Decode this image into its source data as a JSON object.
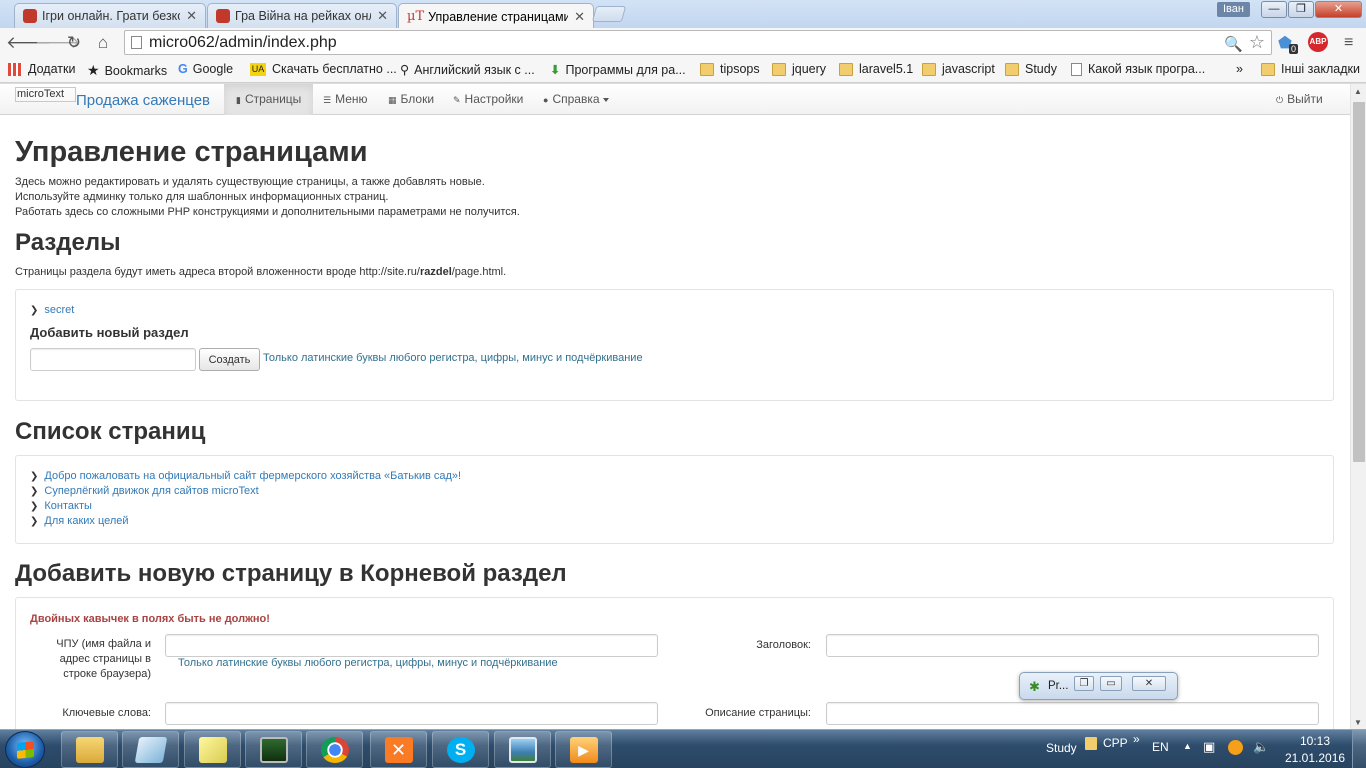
{
  "browser": {
    "tabs": [
      {
        "title": "Ігри онлайн. Грати безкош",
        "active": false
      },
      {
        "title": "Гра Війна на рейках онлай",
        "active": false
      },
      {
        "title": "Управление страницами",
        "active": true,
        "favicon_text": "µT"
      }
    ],
    "user_badge": "Іван",
    "window_buttons": {
      "minimize": "—",
      "maximize": "❐",
      "close": "✕"
    },
    "url": "micro062/admin/index.php",
    "abp_label": "ABP",
    "extension_badge": "0",
    "bookmarks": [
      {
        "label": "Додатки",
        "icon": "apps-icon"
      },
      {
        "label": "Bookmarks",
        "icon": "star-icon"
      },
      {
        "label": "Google",
        "icon": "google-icon"
      },
      {
        "label": "Скачать бесплатно ...",
        "icon": "ua-icon"
      },
      {
        "label": "Английский язык с ...",
        "icon": "runner-icon"
      },
      {
        "label": "Программы для ра...",
        "icon": "download-icon"
      },
      {
        "label": "tipsops",
        "icon": "folder-icon"
      },
      {
        "label": "jquery",
        "icon": "folder-icon"
      },
      {
        "label": "laravel5.1",
        "icon": "folder-icon"
      },
      {
        "label": "javascript",
        "icon": "folder-icon"
      },
      {
        "label": "Study",
        "icon": "folder-icon"
      },
      {
        "label": "Какой язык програ...",
        "icon": "page-icon"
      }
    ],
    "bookmarks_overflow": "»",
    "other_bookmarks": "Інші закладки"
  },
  "site": {
    "brand_img_alt": "microText",
    "brand_title": "Продажа саженцев",
    "nav": [
      {
        "label": "Страницы",
        "icon": "file-icon",
        "active": true
      },
      {
        "label": "Меню",
        "icon": "list-icon",
        "active": false
      },
      {
        "label": "Блоки",
        "icon": "blocks-icon",
        "active": false
      },
      {
        "label": "Настройки",
        "icon": "wrench-icon",
        "active": false
      },
      {
        "label": "Справка",
        "icon": "info-icon",
        "active": false,
        "dropdown": true
      }
    ],
    "logout": "Выйти"
  },
  "main": {
    "title": "Управление страницами",
    "intro": [
      "Здесь можно редактировать и удалять существующие страницы, а также добавлять новые.",
      "Используйте админку только для шаблонных информационных страниц.",
      "Работать здесь со сложными PHP конструкциями и дополнительными параметрами не получится."
    ],
    "sections": {
      "title": "Разделы",
      "note_prefix": "Страницы раздела будут иметь адреса второй вложенности вроде http://site.ru/",
      "note_bold": "razdel",
      "note_suffix": "/page.html.",
      "items": [
        "secret"
      ],
      "add_title": "Добавить новый раздел",
      "add_input_value": "",
      "create_button": "Создать",
      "hint": "Только латинские буквы любого регистра, цифры, минус и подчёркивание"
    },
    "pages": {
      "title": "Список страниц",
      "items": [
        "Добро пожаловать на официальный сайт фермерского хозяйства «Батькив сад»!",
        "Суперлёгкий движок для сайтов microText",
        "Контакты",
        "Для каких целей"
      ]
    },
    "add_page": {
      "title": "Добавить новую страницу в Корневой раздел",
      "warning": "Двойных кавычек в полях быть не должно!",
      "slug_label": "ЧПУ (имя файла и адрес страницы в строке браузера)",
      "slug_hint": "Только латинские буквы любого регистра, цифры, минус и подчёркивание",
      "heading_label": "Заголовок:",
      "keywords_label": "Ключевые слова:",
      "description_label": "Описание страницы:"
    }
  },
  "floating_window": {
    "title": "Pr..."
  },
  "taskbar": {
    "apps": [
      "explorer-icon",
      "notepad-icon",
      "sticky-notes-icon",
      "task-manager-icon",
      "chrome-icon",
      "xampp-icon",
      "skype-icon",
      "photo-viewer-icon",
      "media-player-icon"
    ],
    "tray_study": "Study",
    "tray_cpp": "CPP",
    "tray_overflow": "»",
    "language": "EN",
    "time": "10:13",
    "date": "21.01.2016"
  },
  "colors": {
    "link": "#337ab7",
    "help": "#31708f",
    "warning": "#a94442",
    "taskbar": "#2e4c6c"
  }
}
